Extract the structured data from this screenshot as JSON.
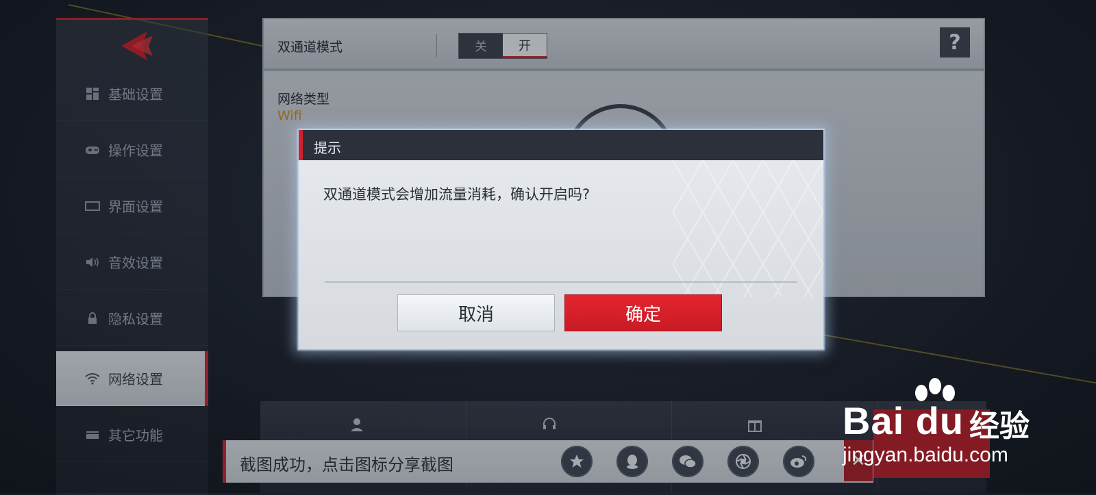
{
  "sidebar": {
    "items": [
      {
        "label": "基础设置",
        "icon": "grid-icon"
      },
      {
        "label": "操作设置",
        "icon": "gamepad-icon"
      },
      {
        "label": "界面设置",
        "icon": "screen-icon"
      },
      {
        "label": "音效设置",
        "icon": "speaker-icon"
      },
      {
        "label": "隐私设置",
        "icon": "lock-icon"
      },
      {
        "label": "网络设置",
        "icon": "wifi-icon",
        "active": true
      },
      {
        "label": "其它功能",
        "icon": "card-icon"
      }
    ]
  },
  "dual_channel": {
    "label": "双通道模式",
    "off_label": "关",
    "on_label": "开",
    "help_label": "?"
  },
  "network": {
    "type_label": "网络类型",
    "type_value": "Wifi"
  },
  "dialog": {
    "title": "提示",
    "message": "双通道模式会增加流量消耗，确认开启吗?",
    "cancel_label": "取消",
    "confirm_label": "确定"
  },
  "share_bar": {
    "message": "截图成功，点击图标分享截图",
    "icons": [
      "star-icon",
      "qq-icon",
      "wechat-icon",
      "moments-icon",
      "weibo-icon"
    ]
  },
  "watermark": {
    "brand": "Bai du",
    "brand_cn": "经验",
    "url": "jingyan.baidu.com"
  },
  "colors": {
    "accent_red": "#d0222c",
    "dialog_title_bg": "#2b303a",
    "wifi_value": "#c98a1e"
  }
}
